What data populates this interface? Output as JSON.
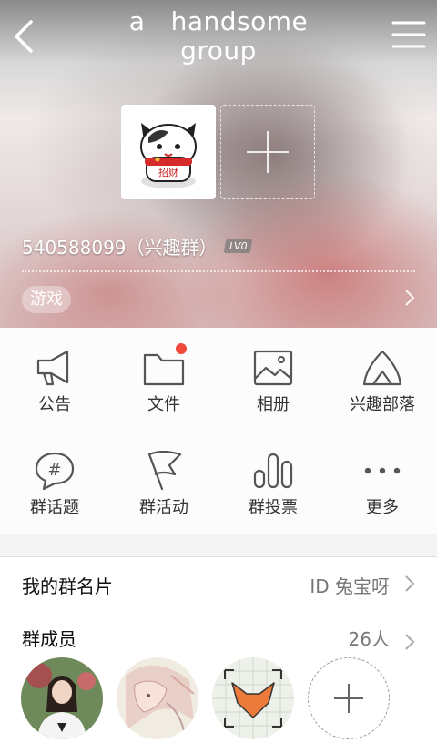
{
  "header": {
    "title_line1": "a   handsome",
    "title_line2": "group",
    "back_icon": "chevron-left-icon",
    "menu_icon": "hamburger-menu-icon"
  },
  "profile": {
    "group_id": "540588099（兴趣群）",
    "level": "LV0",
    "tag": "游戏"
  },
  "features": [
    {
      "label": "公告",
      "icon": "megaphone-icon"
    },
    {
      "label": "文件",
      "icon": "folder-icon",
      "badge": true
    },
    {
      "label": "相册",
      "icon": "photo-album-icon"
    },
    {
      "label": "兴趣部落",
      "icon": "tent-icon"
    },
    {
      "label": "群话题",
      "icon": "hashtag-bubble-icon"
    },
    {
      "label": "群活动",
      "icon": "flag-icon"
    },
    {
      "label": "群投票",
      "icon": "bar-chart-icon"
    },
    {
      "label": "更多",
      "icon": "more-dots-icon"
    }
  ],
  "card_row": {
    "label": "我的群名片",
    "value": "ID 兔宝呀"
  },
  "members_row": {
    "label": "群成员",
    "count": "26人"
  },
  "colors": {
    "badge_red": "#f04a3c",
    "text_dark": "#333333",
    "text_gray": "#777777"
  }
}
